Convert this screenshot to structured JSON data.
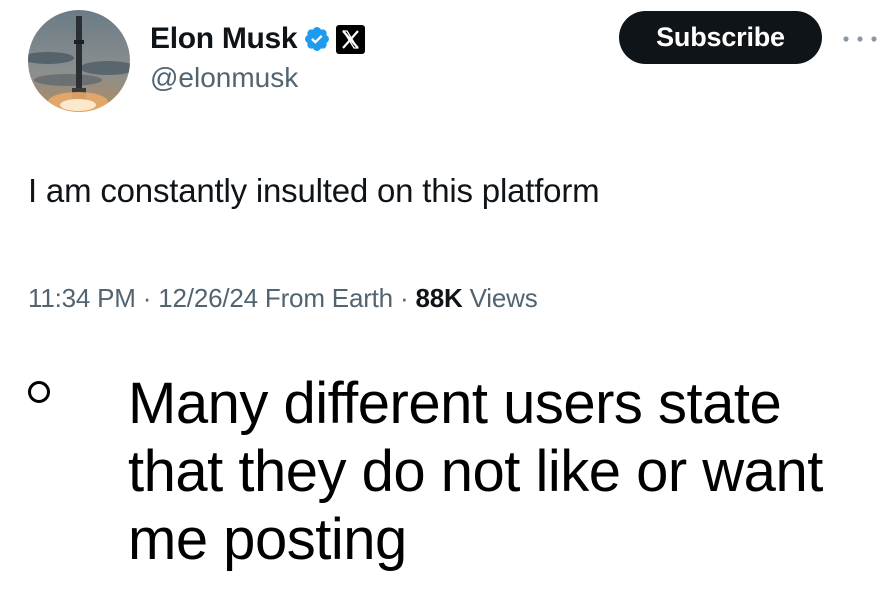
{
  "profile": {
    "display_name": "Elon Musk",
    "handle": "@elonmusk",
    "avatar_icon": "rocket-launch-avatar",
    "verified_icon": "verified-badge-icon",
    "affiliation_icon": "x-logo-icon",
    "verified_color": "#1d9bf0"
  },
  "actions": {
    "subscribe_label": "Subscribe",
    "more_icon": "more-options-icon"
  },
  "tweet": {
    "text": "I am constantly insulted on this platform",
    "time": "11:34 PM",
    "date": "12/26/24",
    "location": "From Earth",
    "views_count": "88K",
    "views_label": "Views"
  },
  "caption": {
    "bullet_text": "Many different users state that they do not like or want me posting"
  },
  "colors": {
    "text_primary": "#0f1419",
    "text_secondary": "#536471",
    "button_bg": "#0f1419"
  }
}
